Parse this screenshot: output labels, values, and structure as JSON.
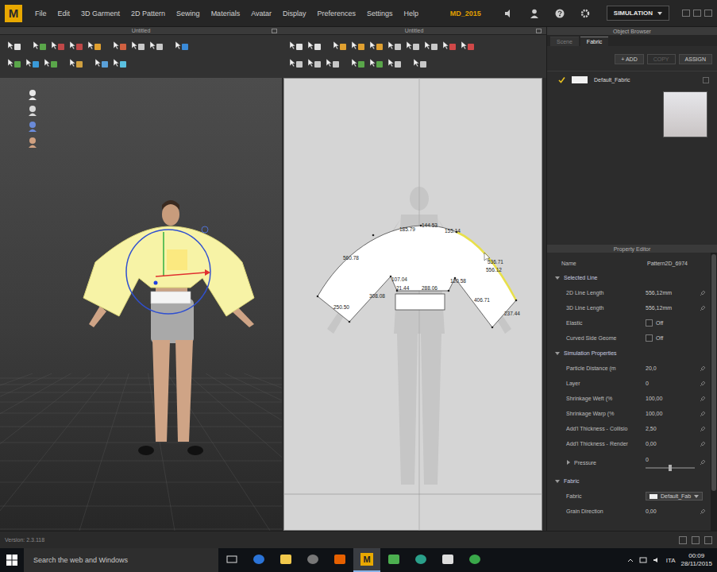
{
  "app": {
    "logo": "M",
    "menu": [
      "File",
      "Edit",
      "3D Garment",
      "2D Pattern",
      "Sewing",
      "Materials",
      "Avatar",
      "Display",
      "Preferences",
      "Settings",
      "Help"
    ],
    "file_label": "MD_2015",
    "mode": "SIMULATION"
  },
  "viewports": [
    {
      "title": "Untitled",
      "kind": "3d"
    },
    {
      "title": "Untitled",
      "kind": "2d"
    }
  ],
  "pattern_labels": [
    "185.79",
    "144.53",
    "155.14",
    "560.78",
    "107.04",
    "21.44",
    "288.06",
    "120.58",
    "308.08",
    "406.71",
    "250.50",
    "237.44",
    "536.71",
    "556.12"
  ],
  "object_browser": {
    "title": "Object Browser",
    "tabs": [
      {
        "label": "Scene",
        "selected": false
      },
      {
        "label": "Fabric",
        "selected": true
      }
    ],
    "buttons": [
      {
        "label": "+ ADD",
        "disabled": false
      },
      {
        "label": "COPY",
        "disabled": true
      },
      {
        "label": "ASSIGN",
        "disabled": false
      }
    ],
    "fabrics": [
      {
        "name": "Default_Fabric",
        "checked": true
      }
    ]
  },
  "property_editor": {
    "title": "Property Editor",
    "name_label": "Name",
    "name_value": "Pattern2D_6974",
    "sections": [
      {
        "title": "Selected Line",
        "expanded": true,
        "rows": [
          {
            "label": "2D Line Length",
            "kind": "text",
            "value": "556,12mm"
          },
          {
            "label": "3D Line Length",
            "kind": "text",
            "value": "556,12mm"
          },
          {
            "label": "Elastic",
            "kind": "checkbox",
            "value": "Off",
            "checked": false
          },
          {
            "label": "Curved Side Geome",
            "kind": "checkbox",
            "value": "Off",
            "checked": false
          }
        ]
      },
      {
        "title": "Simulation Properties",
        "expanded": true,
        "rows": [
          {
            "label": "Particle Distance (m",
            "kind": "text",
            "value": "20,0"
          },
          {
            "label": "Layer",
            "kind": "text",
            "value": "0"
          },
          {
            "label": "Shrinkage Weft (%",
            "kind": "text",
            "value": "100,00"
          },
          {
            "label": "Shrinkage Warp (%",
            "kind": "text",
            "value": "100,00"
          },
          {
            "label": "Add'l Thickness - Collisio",
            "kind": "text",
            "value": "2,50"
          },
          {
            "label": "Add'l Thickness - Render",
            "kind": "text",
            "value": "0,00"
          },
          {
            "label": "Pressure",
            "kind": "slider",
            "value": "0",
            "level": 0.5,
            "expanded": false
          }
        ]
      },
      {
        "title": "Fabric",
        "expanded": true,
        "rows": [
          {
            "label": "Fabric",
            "kind": "dropdown",
            "value": "Default_Fab"
          },
          {
            "label": "Grain Direction",
            "kind": "text",
            "value": "0,00"
          }
        ]
      }
    ]
  },
  "status_bar": {
    "version": "Version: 2.3.118"
  },
  "taskbar": {
    "search": "Search the web and Windows",
    "language": "ITA",
    "time": "00:09",
    "date": "28/11/2015"
  }
}
